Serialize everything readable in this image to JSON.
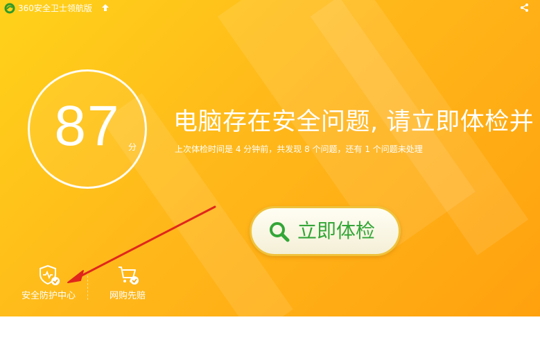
{
  "app": {
    "title": "360安全卫士领航版"
  },
  "score": {
    "value": "87",
    "unit": "分"
  },
  "status": {
    "headline": "电脑存在安全问题, 请立即体检并",
    "detail": "上次体检时间是 4 分钟前，共发现 8 个问题，还有 1 个问题未处理"
  },
  "action": {
    "check_now_label": "立即体检"
  },
  "shortcuts": [
    {
      "label": "安全防护中心",
      "icon": "shield-check-icon"
    },
    {
      "label": "网购先赔",
      "icon": "cart-check-icon"
    }
  ],
  "colors": {
    "background": "#ffb81a",
    "accent_green": "#33a637",
    "annotation_arrow": "#e0261c"
  }
}
